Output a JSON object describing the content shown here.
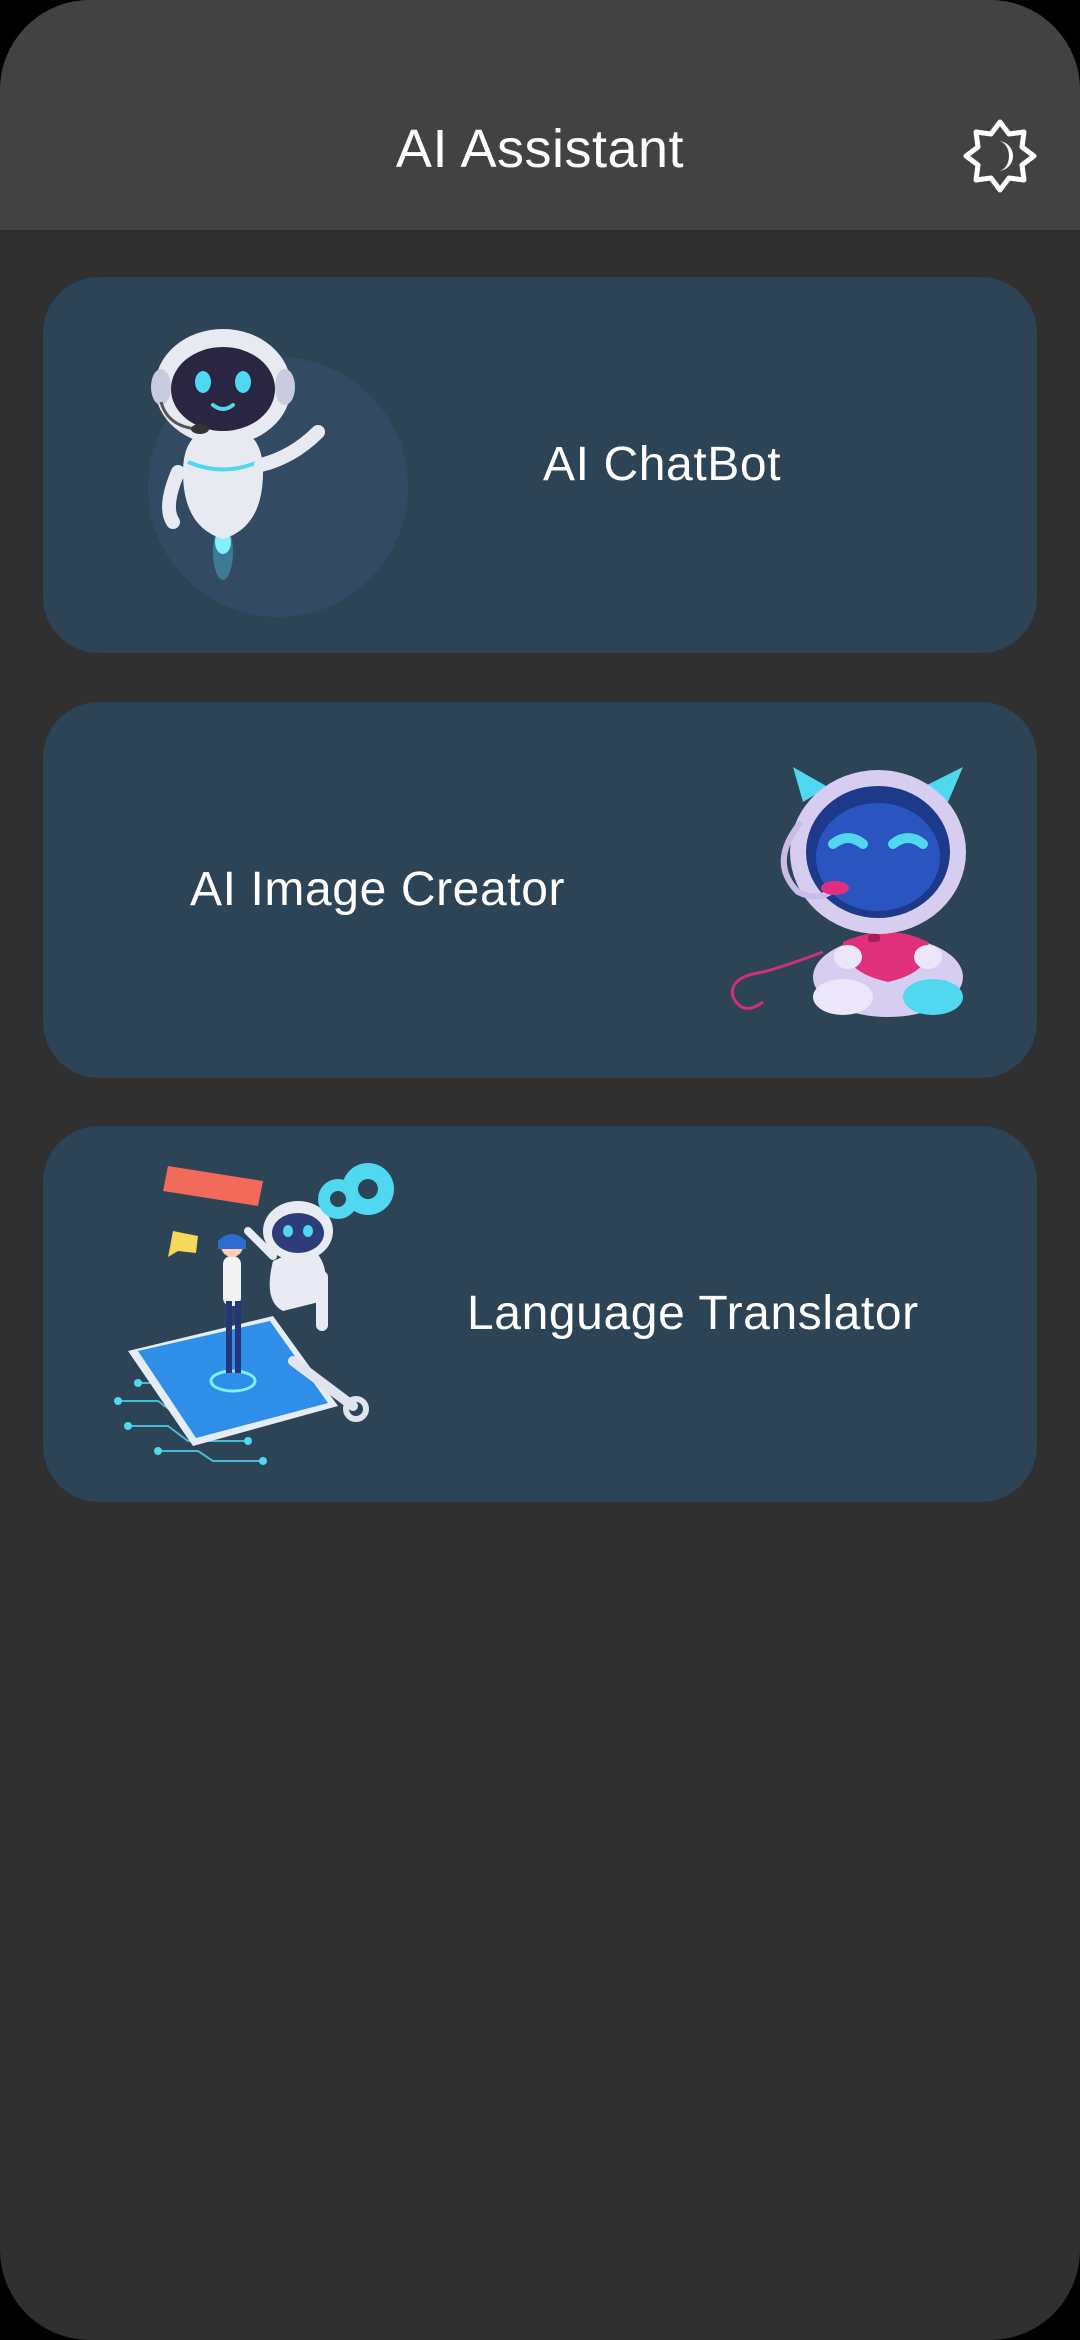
{
  "appbar": {
    "title": "AI Assistant",
    "theme_toggle_icon": "brightness-auto-icon"
  },
  "cards": [
    {
      "label": "AI ChatBot",
      "illustration": "chatbot-robot-illustration"
    },
    {
      "label": "AI Image Creator",
      "illustration": "gamer-robot-illustration"
    },
    {
      "label": "Language Translator",
      "illustration": "translator-robot-illustration"
    }
  ],
  "colors": {
    "background": "#303030",
    "appbar": "#424242",
    "card": "#2d4356",
    "text": "#ffffff",
    "accent": "#4fd8f0"
  }
}
